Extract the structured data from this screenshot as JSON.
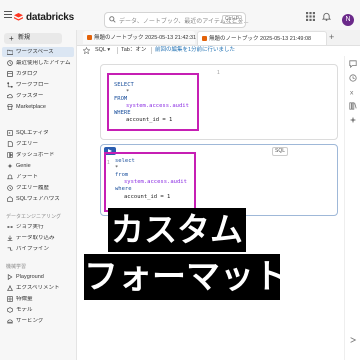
{
  "app": {
    "brand": "databricks",
    "avatar_letter": "N"
  },
  "search": {
    "placeholder": "データ、ノートブック、最近のアイテムなどを...",
    "shortcut": "Ctrl+P"
  },
  "sidebar": {
    "new_label": "新規",
    "items": [
      {
        "label": "ワークスペース",
        "icon": "folder-icon",
        "active": true
      },
      {
        "label": "最近使用したアイテム",
        "icon": "clock-icon"
      },
      {
        "label": "カタログ",
        "icon": "catalog-icon"
      },
      {
        "label": "ワークフロー",
        "icon": "workflow-icon"
      },
      {
        "label": "クラスター",
        "icon": "cloud-icon"
      },
      {
        "label": "Marketplace",
        "icon": "store-icon"
      }
    ],
    "sql_items": [
      {
        "label": "SQLエディタ",
        "icon": "sql-editor-icon"
      },
      {
        "label": "クエリー",
        "icon": "query-icon"
      },
      {
        "label": "ダッシュボード",
        "icon": "dashboard-icon"
      },
      {
        "label": "Genie",
        "icon": "genie-icon"
      },
      {
        "label": "アラート",
        "icon": "bell-icon"
      },
      {
        "label": "クエリー履歴",
        "icon": "history-icon"
      },
      {
        "label": "SQLウェアハウス",
        "icon": "warehouse-icon"
      }
    ],
    "data_eng_heading": "データエンジニアリング",
    "data_eng_items": [
      {
        "label": "ジョブ実行",
        "icon": "jobs-icon"
      },
      {
        "label": "データ取り込み",
        "icon": "ingest-icon"
      },
      {
        "label": "パイプライン",
        "icon": "pipeline-icon"
      }
    ],
    "ml_heading": "機械学習",
    "ml_items": [
      {
        "label": "Playground",
        "icon": "playground-icon"
      },
      {
        "label": "エクスペリメント",
        "icon": "experiment-icon"
      },
      {
        "label": "特徴量",
        "icon": "feature-icon"
      },
      {
        "label": "モデル",
        "icon": "model-icon"
      },
      {
        "label": "サービング",
        "icon": "serving-icon"
      }
    ]
  },
  "tabs": [
    {
      "label": "無題のノートブック 2025-05-13 21:42:31"
    },
    {
      "label": "無題のノートブック 2025-05-13 21:49:08"
    }
  ],
  "toolbar": {
    "language": "SQL ▾",
    "table_toggle": "Tab：オン",
    "saved_note": "前回の編集を1分前に行いました"
  },
  "cell1": {
    "number": "1",
    "code": {
      "select": "SELECT",
      "star": "*",
      "from": "FROM",
      "table": "system.access.audit",
      "where": "WHERE",
      "condition": "account_id = 1"
    }
  },
  "cell2": {
    "number": "1",
    "badge": "SQL",
    "code": {
      "select": "select",
      "star": "*",
      "from": "from",
      "table": "system.access.audit",
      "where": "where",
      "condition": "account_id = 1"
    }
  },
  "caption": {
    "line1": "カスタム",
    "line2": "フォーマット"
  },
  "colors": {
    "highlight": "#c61fb4",
    "keyword": "#1a4f9c",
    "accent": "#2a5db0"
  }
}
